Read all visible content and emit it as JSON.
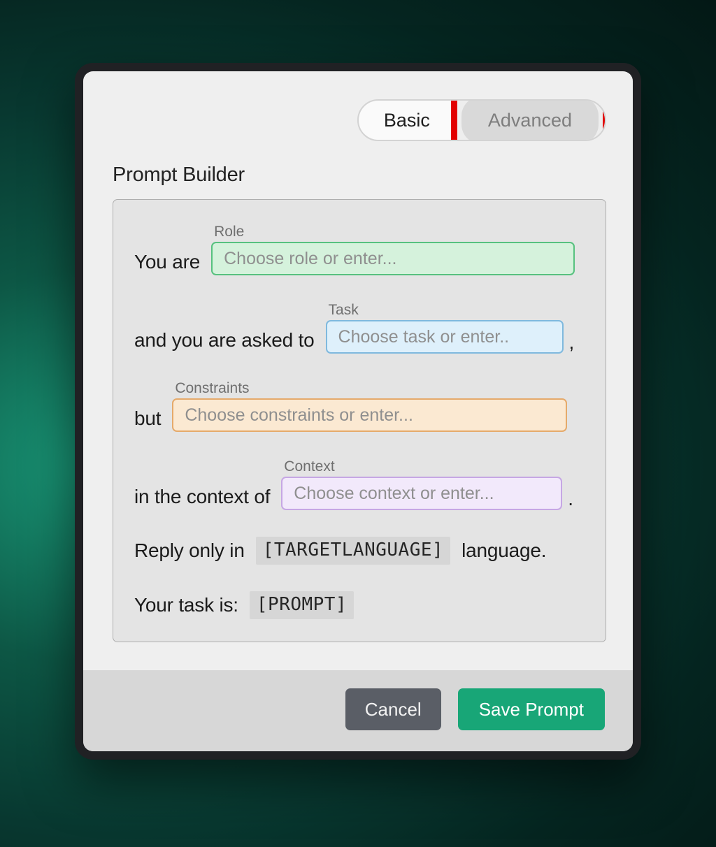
{
  "tabs": {
    "basic": "Basic",
    "advanced": "Advanced"
  },
  "title": "Prompt Builder",
  "builder": {
    "line1_prefix": "You are",
    "role_label": "Role",
    "role_placeholder": "Choose role or enter...",
    "line2_prefix": "and you are asked to",
    "task_label": "Task",
    "task_placeholder": "Choose task or enter..",
    "line2_suffix": ",",
    "line3_prefix": "but",
    "constraints_label": "Constraints",
    "constraints_placeholder": "Choose constraints or enter...",
    "line4_prefix": "in the context of",
    "context_label": "Context",
    "context_placeholder": "Choose context or enter...",
    "line4_suffix": ".",
    "line5_prefix": "Reply only in",
    "line5_token": "[TARGETLANGUAGE]",
    "line5_suffix": "language.",
    "line6_prefix": "Your task is:",
    "line6_token": "[PROMPT]"
  },
  "buttons": {
    "cancel": "Cancel",
    "save": "Save Prompt"
  }
}
